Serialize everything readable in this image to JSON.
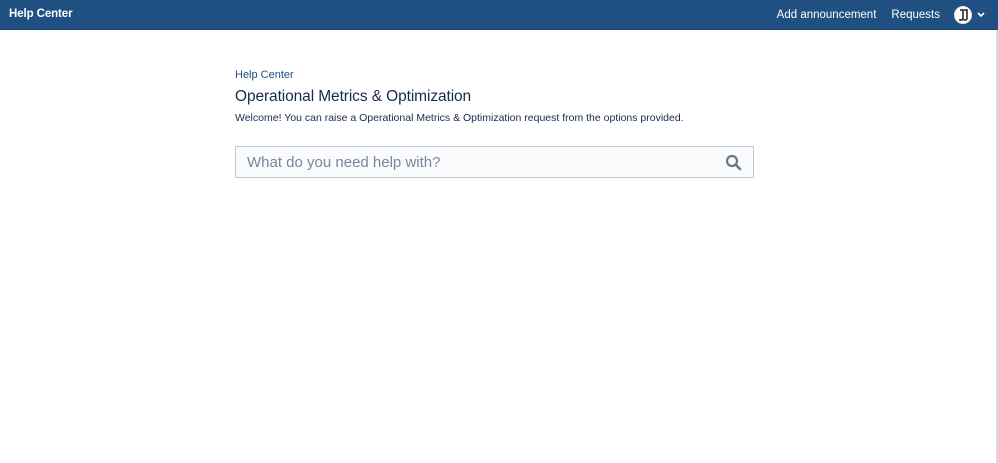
{
  "header": {
    "title": "Help Center",
    "nav": {
      "add_announcement": "Add announcement",
      "requests": "Requests"
    },
    "profile": {
      "avatar_icon": "user-avatar-icon",
      "menu_icon": "chevron-down-icon"
    },
    "colors": {
      "bar": "#205081",
      "text": "#ffffff"
    }
  },
  "main": {
    "breadcrumb": "Help Center",
    "title": "Operational Metrics & Optimization",
    "welcome": "Welcome! You can raise a Operational Metrics & Optimization request from the options provided.",
    "search": {
      "placeholder": "What do you need help with?",
      "value": "",
      "icon": "search-icon"
    }
  }
}
